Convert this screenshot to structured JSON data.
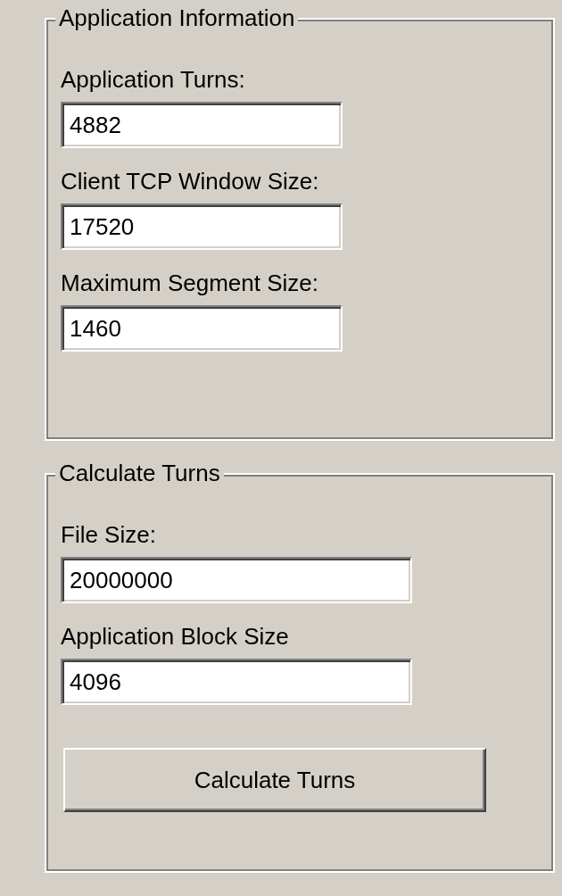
{
  "groups": [
    {
      "title": "Application Information",
      "fields": [
        {
          "label": "Application Turns:",
          "value": "4882"
        },
        {
          "label": "Client TCP Window Size:",
          "value": "17520"
        },
        {
          "label": "Maximum Segment Size:",
          "value": "1460"
        }
      ]
    },
    {
      "title": "Calculate Turns",
      "fields": [
        {
          "label": "File Size:",
          "value": "20000000"
        },
        {
          "label": "Application Block Size",
          "value": "4096"
        }
      ],
      "button": "Calculate Turns"
    }
  ]
}
